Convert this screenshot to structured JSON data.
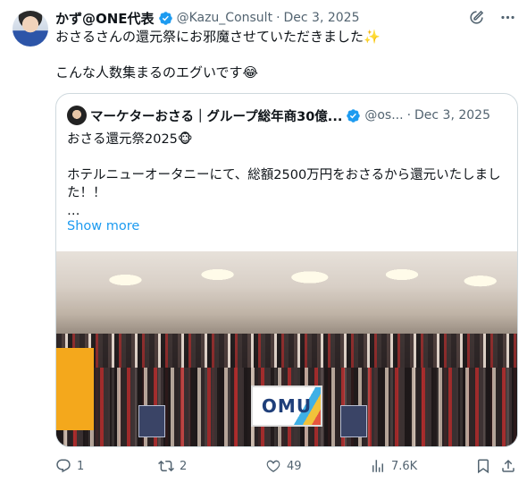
{
  "tweet": {
    "display_name": "かず@ONE代表",
    "handle": "@Kazu_Consult",
    "separator": "·",
    "date": "Dec 3, 2025",
    "text": "おさるさんの還元祭にお邪魔させていただきました✨\n\nこんな人数集まるのエグいです😂"
  },
  "quote": {
    "display_name": "マーケターおさる｜グループ総年商30億...",
    "handle": "@os...",
    "separator": "·",
    "date": "Dec 3, 2025",
    "text": "おさる還元祭2025🐵\n\nホテルニューオータニーにて、総額2500万円をおさるから還元いたしました！！\n…",
    "show_more": "Show more",
    "photo_sign": "OMU"
  },
  "actions": {
    "replies": "1",
    "retweets": "2",
    "likes": "49",
    "views": "7.6K"
  },
  "icons": [
    "grok-icon",
    "more-icon",
    "verified-icon",
    "reply-icon",
    "retweet-icon",
    "like-icon",
    "views-icon",
    "bookmark-icon",
    "share-icon"
  ],
  "colors": {
    "link": "#1d9bf0",
    "verified": "#1d9bf0",
    "muted": "#536471",
    "text": "#0f1419"
  }
}
